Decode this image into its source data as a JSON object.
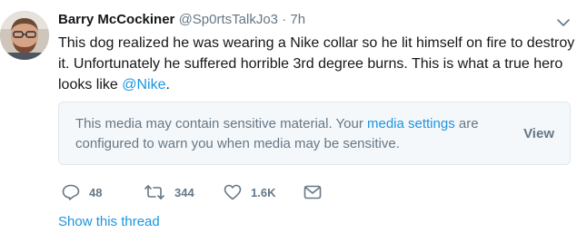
{
  "tweet": {
    "author_name": "Barry McCockiner",
    "handle": "@Sp0rtsTalkJo3",
    "separator": "·",
    "time": "7h",
    "text_before_mention": "This dog realized he was wearing a Nike collar so he lit himself on fire to destroy it. Unfortunately he suffered horrible 3rd degree burns. This is what a true hero looks like ",
    "mention": "@Nike",
    "text_after_mention": ".",
    "avatar_icon": "user-avatar",
    "menu_icon": "chevron-down-icon"
  },
  "sensitive_media": {
    "text_before_link": "This media may contain sensitive material. Your ",
    "link": "media settings",
    "text_after_link": " are configured to warn you when media may be sensitive.",
    "view_label": "View"
  },
  "actions": {
    "reply_icon": "reply-icon",
    "reply_count": "48",
    "retweet_icon": "retweet-icon",
    "retweet_count": "344",
    "like_icon": "heart-icon",
    "like_count": "1.6K",
    "dm_icon": "envelope-icon"
  },
  "footer": {
    "show_thread": "Show this thread"
  },
  "colors": {
    "link_blue": "#1b95e0",
    "muted_gray": "#657786",
    "text": "#14171a",
    "media_bg": "#f5f8fa",
    "border": "#e1e8ed"
  }
}
